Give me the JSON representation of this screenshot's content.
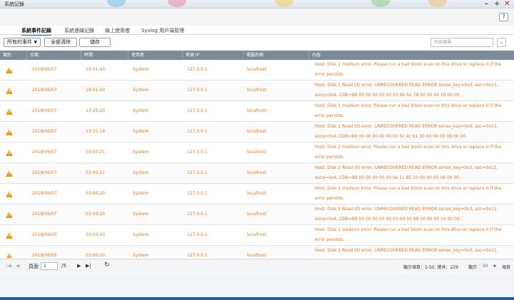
{
  "window": {
    "title": "系統記錄",
    "controls": {
      "minimize": "–",
      "maximize": "+",
      "close": "✕"
    },
    "help": "?"
  },
  "tabs": [
    {
      "label": "系統事件記錄",
      "active": true
    },
    {
      "label": "系統連線記錄",
      "active": false
    },
    {
      "label": "線上使用者",
      "active": false
    },
    {
      "label": "Syslog 用戶端管理",
      "active": false
    }
  ],
  "toolbar": {
    "filter_select": "所有的事件",
    "clear_all": "全部清除",
    "save": "儲存",
    "search_placeholder": "內容搜尋"
  },
  "table": {
    "headers": [
      "類別",
      "日期",
      "時間",
      "使用者",
      "來源 IP",
      "電腦名稱",
      "內容"
    ],
    "rows": [
      {
        "date": "2018/06/07",
        "time": "19:01:43",
        "user": "System",
        "ip": "127.0.0.1",
        "host": "localhost",
        "content": "Host: Disk 1 medium error. Please run a bad block scan on this drive or replace it if the error persists."
      },
      {
        "date": "2018/06/07",
        "time": "19:01:43",
        "user": "System",
        "ip": "127.0.0.1",
        "host": "localhost",
        "content": "Host: Disk 1 Read I/O error, UNRECOVERED READ ERROR sense_key=0x3, asc=0x11, ascq=0x4, CDB=88 00 00 00 00 00 03 9b b1 78 00 00 00 10 00 00 ."
      },
      {
        "date": "2018/06/07",
        "time": "13:25:20",
        "user": "System",
        "ip": "127.0.0.1",
        "host": "localhost",
        "content": "Host: Disk 1 medium error. Please run a bad block scan on this drive or replace it if the error persists."
      },
      {
        "date": "2018/06/07",
        "time": "13:25:19",
        "user": "System",
        "ip": "127.0.0.1",
        "host": "localhost",
        "content": "Host: Disk 1 Read I/O error, UNRECOVERED READ ERROR sense_key=0x3, asc=0x11, ascq=0x4, CDB=88 00 00 00 00 00 01 5c 4c b1 30 00 00 00 08 00 00 ."
      },
      {
        "date": "2018/06/07",
        "time": "03:00:21",
        "user": "System",
        "ip": "127.0.0.1",
        "host": "localhost",
        "content": "Host: Disk 2 medium error. Please run a bad block scan on this drive or replace it if the error persists."
      },
      {
        "date": "2018/06/07",
        "time": "03:00:21",
        "user": "System",
        "ip": "127.0.0.1",
        "host": "localhost",
        "content": "Host: Disk 2 Read I/O error, UNRECOVERED READ ERROR sense_key=0x3, asc=0x11, ascq=0x4, CDB=88 00 00 00 00 00 0e 1c 85 10 00 00 00 08 00 00 ."
      },
      {
        "date": "2018/06/07",
        "time": "03:00:20",
        "user": "System",
        "ip": "127.0.0.1",
        "host": "localhost",
        "content": "Host: Disk 1 medium error. Please run a bad block scan on this drive or replace it if the error persists."
      },
      {
        "date": "2018/06/07",
        "time": "03:00:20",
        "user": "System",
        "ip": "127.0.0.1",
        "host": "localhost",
        "content": "Host: Disk 1 Read I/O error, UNRECOVERED READ ERROR sense_key=0x3, asc=0x11, ascq=0x4, CDB=88 00 00 00 00 00 03 9d 50 88 00 00 00 10 00 00 ."
      },
      {
        "date": "2018/06/05",
        "time": "03:00:20",
        "user": "System",
        "ip": "127.0.0.1",
        "host": "localhost",
        "content": "Host: Disk 1 medium error. Please run a bad block scan on this drive or replace it if the error persists."
      },
      {
        "date": "2018/06/05",
        "time": "03:00:20",
        "user": "System",
        "ip": "127.0.0.1",
        "host": "localhost",
        "content": "Host: Disk 1 Read I/O error, UNRECOVERED READ ERROR sense_key=0x3, asc=0x11, ascq=0x4,"
      }
    ]
  },
  "pager": {
    "page_label": "頁面",
    "current_page": "1",
    "total_pages": "/5",
    "summary": "顯示項目：1-50, 總共：229",
    "per_page_label": "顯示",
    "per_page": "50",
    "items_label": "項目"
  },
  "icons": {
    "warning": "warning-icon",
    "refresh": "refresh-icon"
  },
  "colors": {
    "accent": "#2b6cb6",
    "warning_text": "#e07b2a",
    "warning_icon": "#e8a010",
    "close": "#d02020"
  }
}
